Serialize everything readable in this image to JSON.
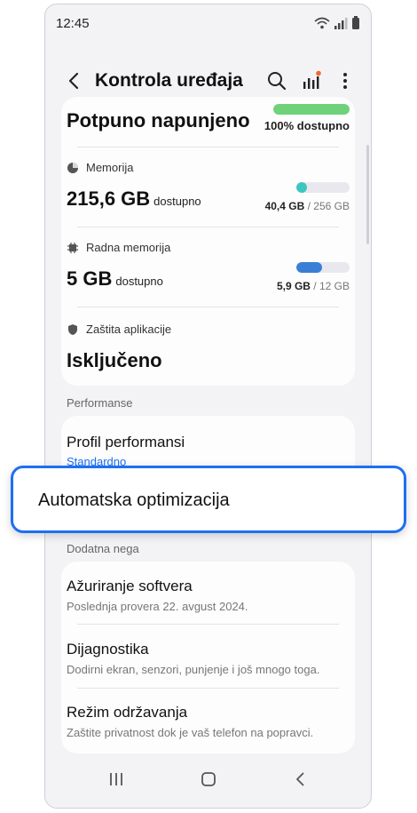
{
  "status": {
    "time": "12:45"
  },
  "appbar": {
    "title": "Kontrola uređaja"
  },
  "battery": {
    "value": "Potpuno napunjeno",
    "available": "100% dostupno",
    "level": 1.0,
    "color": "#6fd27a"
  },
  "storage": {
    "label": "Memorija",
    "value": "215,6 GB",
    "unit": "dostupno",
    "used": "40,4 GB",
    "separator": " / ",
    "total": "256 GB",
    "fraction": 0.16,
    "color": "#3cc6c0"
  },
  "ram": {
    "label": "Radna memorija",
    "value": "5 GB",
    "unit": "dostupno",
    "used": "5,9 GB",
    "separator": " / ",
    "total": "12 GB",
    "fraction": 0.49,
    "color": "#3a7fd6"
  },
  "app_protection": {
    "label": "Zaštita aplikacije",
    "value": "Isključeno"
  },
  "performance": {
    "header": "Performanse",
    "profile_title": "Profil performansi",
    "profile_value": "Standardno",
    "accent": "#1d6ff2"
  },
  "highlight": {
    "label": "Automatska optimizacija"
  },
  "additional": {
    "header": "Dodatna nega",
    "items": [
      {
        "title": "Ažuriranje softvera",
        "subtitle": "Poslednja provera 22. avgust 2024."
      },
      {
        "title": "Dijagnostika",
        "subtitle": "Dodirni ekran, senzori, punjenje i još mnogo toga."
      },
      {
        "title": "Režim održavanja",
        "subtitle": "Zaštite privatnost dok je vaš telefon na popravci."
      }
    ]
  },
  "icons": [
    "back-arrow-icon",
    "search-icon",
    "chart-icon",
    "more-vert-icon",
    "pie-icon",
    "chip-icon",
    "shield-icon",
    "wifi-icon",
    "signal-icon",
    "recents-icon",
    "home-icon",
    "back-nav-icon"
  ]
}
